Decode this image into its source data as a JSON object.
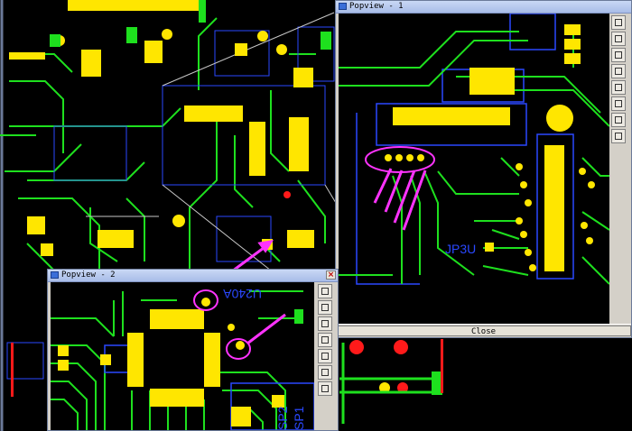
{
  "windows": {
    "popview1": {
      "title": "Popview - 1",
      "close_label": "Close"
    },
    "popview2": {
      "title": "Popview - 2"
    }
  },
  "board_labels": {
    "u240a": "U240A",
    "sp2": "SP2",
    "sp1": "SP1",
    "jp3": "JP3U"
  },
  "icons": {
    "close": "close-icon",
    "window": "window-icon"
  },
  "colors": {
    "trace": "#1ee01e",
    "pad": "#ffe600",
    "outline": "#2a48ff",
    "annotation": "#ff33ff",
    "via_red": "#ff1a1a"
  }
}
